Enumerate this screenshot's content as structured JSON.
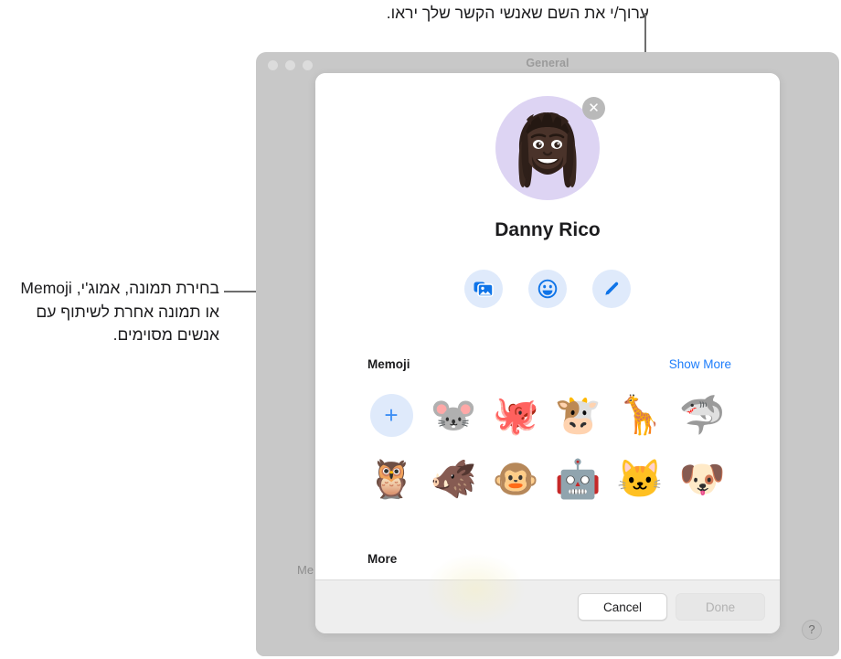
{
  "callouts": {
    "top": "ערוך/י את השם שאנשי הקשר שלך יראו.",
    "left": "בחירת תמונה, אמוג'י, Memoji או תמונה אחרת לשיתוף עם אנשים מסוימים."
  },
  "window": {
    "title": "General",
    "ghost_label": "Me",
    "help_label": "?"
  },
  "sheet": {
    "person_name": "Danny Rico",
    "close_label": "✕",
    "actions": [
      {
        "name": "photos-button",
        "icon": "photos-icon"
      },
      {
        "name": "emoji-button",
        "icon": "smiley-icon"
      },
      {
        "name": "edit-button",
        "icon": "pencil-icon"
      }
    ],
    "memoji_section": {
      "title": "Memoji",
      "link": "Show More",
      "add_label": "+",
      "items": [
        {
          "name": "mouse",
          "glyph": "🐭"
        },
        {
          "name": "octopus",
          "glyph": "🐙"
        },
        {
          "name": "cow",
          "glyph": "🐮"
        },
        {
          "name": "giraffe",
          "glyph": "🦒"
        },
        {
          "name": "shark",
          "glyph": "🦈"
        },
        {
          "name": "owl",
          "glyph": "🦉"
        },
        {
          "name": "boar",
          "glyph": "🐗"
        },
        {
          "name": "monkey",
          "glyph": "🐵"
        },
        {
          "name": "robot",
          "glyph": "🤖"
        },
        {
          "name": "cat",
          "glyph": "🐱"
        },
        {
          "name": "dog",
          "glyph": "🐶"
        }
      ]
    },
    "more_section": {
      "title": "More"
    },
    "footer": {
      "cancel": "Cancel",
      "done": "Done"
    }
  },
  "colors": {
    "accent_blue": "#1d7dfb",
    "action_bg": "#dfeafb",
    "avatar_bg": "#ddd4f3",
    "window_gray": "#c8c8c8",
    "footer_gray": "#eeeeee"
  }
}
